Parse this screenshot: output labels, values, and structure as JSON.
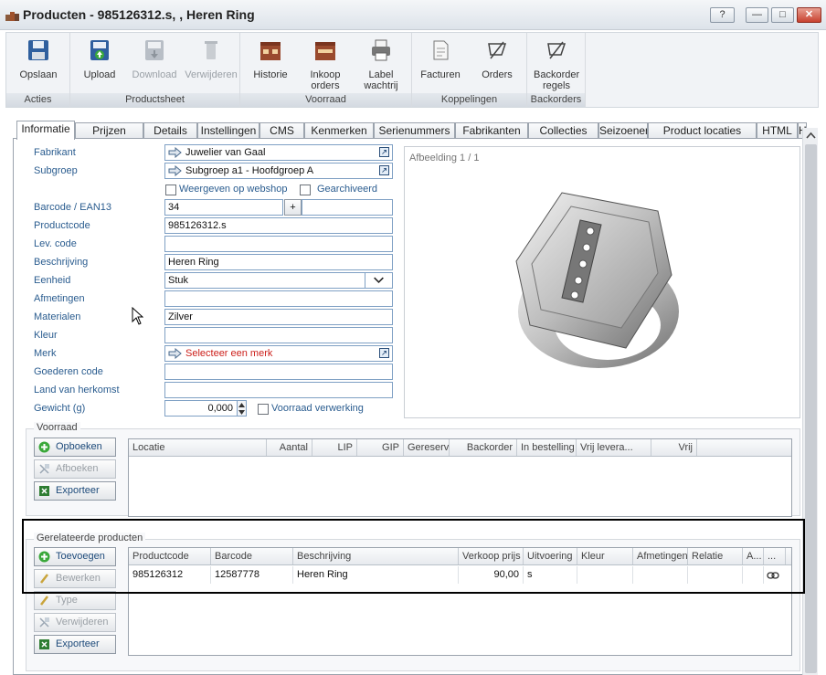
{
  "window": {
    "title": "Producten - 985126312.s, , Heren Ring",
    "help_label": "?"
  },
  "ribbon": {
    "groups": [
      {
        "label": "Acties",
        "buttons": [
          {
            "label": "Opslaan",
            "icon": "save-icon"
          }
        ]
      },
      {
        "label": "Productsheet",
        "buttons": [
          {
            "label": "Upload",
            "icon": "upload-icon"
          },
          {
            "label": "Download",
            "icon": "download-icon",
            "disabled": true
          },
          {
            "label": "Verwijderen",
            "icon": "delete-icon",
            "disabled": true
          }
        ]
      },
      {
        "label": "Voorraad",
        "buttons": [
          {
            "label": "Historie",
            "icon": "history-icon"
          },
          {
            "label": "Inkoop orders",
            "icon": "purchase-orders-icon"
          },
          {
            "label": "Label wachtrij",
            "icon": "printer-icon"
          }
        ]
      },
      {
        "label": "Koppelingen",
        "buttons": [
          {
            "label": "Facturen",
            "icon": "invoices-icon"
          },
          {
            "label": "Orders",
            "icon": "orders-icon"
          }
        ]
      },
      {
        "label": "Backorders",
        "buttons": [
          {
            "label": "Backorder regels",
            "icon": "backorder-icon"
          }
        ]
      }
    ]
  },
  "tabs": [
    "Informatie",
    "Prijzen",
    "Details",
    "Instellingen",
    "CMS",
    "Kenmerken",
    "Serienummers",
    "Fabrikanten",
    "Collecties",
    "Seizoenen",
    "Product locaties",
    "HTML",
    "H"
  ],
  "form": {
    "fabrikant": {
      "label": "Fabrikant",
      "value": "Juwelier van Gaal"
    },
    "subgroep": {
      "label": "Subgroep",
      "value": "Subgroep a1 - Hoofdgroep A"
    },
    "webshop_label": "Weergeven op webshop",
    "archived_label": "Gearchiveerd",
    "barcode": {
      "label": "Barcode / EAN13",
      "value": "34",
      "add_label": "+"
    },
    "productcode": {
      "label": "Productcode",
      "value": "985126312.s"
    },
    "lev_code": {
      "label": "Lev. code",
      "value": ""
    },
    "beschrijving": {
      "label": "Beschrijving",
      "value": "Heren Ring"
    },
    "eenheid": {
      "label": "Eenheid",
      "value": "Stuk"
    },
    "afmetingen": {
      "label": "Afmetingen",
      "value": ""
    },
    "materialen": {
      "label": "Materialen",
      "value": "Zilver"
    },
    "kleur": {
      "label": "Kleur",
      "value": ""
    },
    "merk": {
      "label": "Merk",
      "value": "Selecteer een merk"
    },
    "goederen_code": {
      "label": "Goederen code",
      "value": ""
    },
    "land": {
      "label": "Land van herkomst",
      "value": ""
    },
    "gewicht": {
      "label": "Gewicht (g)",
      "value": "0,000"
    },
    "voorraad_verwerking_label": "Voorraad verwerking"
  },
  "image_panel": {
    "caption": "Afbeelding 1 / 1"
  },
  "voorraad": {
    "title": "Voorraad",
    "buttons": [
      {
        "label": "Opboeken"
      },
      {
        "label": "Afboeken",
        "disabled": true
      },
      {
        "label": "Exporteer"
      }
    ],
    "columns": [
      "Locatie",
      "Aantal",
      "LIP",
      "GIP",
      "Gereserv...",
      "Backorder",
      "In bestelling",
      "Vrij levera...",
      "Vrij"
    ]
  },
  "gerelateerd": {
    "title": "Gerelateerde producten",
    "buttons": [
      {
        "label": "Toevoegen"
      },
      {
        "label": "Bewerken",
        "disabled": true
      },
      {
        "label": "Type",
        "disabled": true
      },
      {
        "label": "Verwijderen",
        "disabled": true
      },
      {
        "label": "Exporteer"
      }
    ],
    "columns": [
      "Productcode",
      "Barcode",
      "Beschrijving",
      "Verkoop prijs",
      "Uitvoering",
      "Kleur",
      "Afmetingen",
      "Relatie",
      "A...",
      "..."
    ],
    "rows": [
      {
        "productcode": "985126312",
        "barcode": "12587778",
        "beschrijving": "Heren Ring",
        "prijs": "90,00",
        "uitvoering": "s",
        "kleur": "",
        "afmetingen": "",
        "relatie": "",
        "a": ""
      }
    ]
  },
  "colors": {
    "accent": "#2a5c8f",
    "link_red": "#cc1f1a",
    "field_border": "#7fa0c4"
  }
}
